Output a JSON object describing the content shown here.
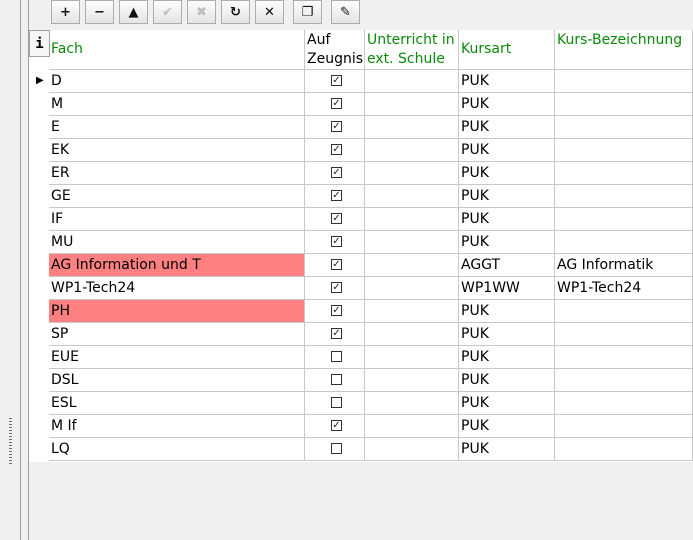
{
  "toolbar": {
    "buttons": [
      {
        "name": "add-button",
        "glyph": "+",
        "enabled": true
      },
      {
        "name": "remove-button",
        "glyph": "−",
        "enabled": true
      },
      {
        "name": "move-up-button",
        "glyph": "▲",
        "enabled": true
      },
      {
        "name": "confirm-button",
        "glyph": "✔",
        "enabled": false
      },
      {
        "name": "cancel-button",
        "glyph": "✖",
        "enabled": false
      },
      {
        "name": "refresh-button",
        "glyph": "↻",
        "enabled": true
      },
      {
        "name": "delete-document-button",
        "glyph": "✕",
        "enabled": true
      },
      {
        "name": "copy-document-button",
        "glyph": "❐",
        "enabled": true
      },
      {
        "name": "edit-document-button",
        "glyph": "✎",
        "enabled": true
      }
    ]
  },
  "grid": {
    "info_label": "i",
    "columns": [
      {
        "label": "Fach"
      },
      {
        "label": "Auf Zeugnis"
      },
      {
        "label": "Unterricht in ext. Schule"
      },
      {
        "label": "Kursart"
      },
      {
        "label": "Kurs-Bezeichnung"
      }
    ],
    "rows": [
      {
        "fach": "D",
        "checked": true,
        "ext": "",
        "kursart": "PUK",
        "bez": "",
        "highlight": false,
        "current": true
      },
      {
        "fach": "M",
        "checked": true,
        "ext": "",
        "kursart": "PUK",
        "bez": "",
        "highlight": false
      },
      {
        "fach": "E",
        "checked": true,
        "ext": "",
        "kursart": "PUK",
        "bez": "",
        "highlight": false
      },
      {
        "fach": "EK",
        "checked": true,
        "ext": "",
        "kursart": "PUK",
        "bez": "",
        "highlight": false
      },
      {
        "fach": "ER",
        "checked": true,
        "ext": "",
        "kursart": "PUK",
        "bez": "",
        "highlight": false
      },
      {
        "fach": "GE",
        "checked": true,
        "ext": "",
        "kursart": "PUK",
        "bez": "",
        "highlight": false
      },
      {
        "fach": "IF",
        "checked": true,
        "ext": "",
        "kursart": "PUK",
        "bez": "",
        "highlight": false
      },
      {
        "fach": "MU",
        "checked": true,
        "ext": "",
        "kursart": "PUK",
        "bez": "",
        "highlight": false
      },
      {
        "fach": "AG Information und T",
        "checked": true,
        "ext": "",
        "kursart": "AGGT",
        "bez": "AG Informatik",
        "highlight": true
      },
      {
        "fach": "WP1-Tech24",
        "checked": true,
        "ext": "",
        "kursart": "WP1WW",
        "bez": "WP1-Tech24",
        "highlight": false
      },
      {
        "fach": "PH",
        "checked": true,
        "ext": "",
        "kursart": "PUK",
        "bez": "",
        "highlight": true
      },
      {
        "fach": "SP",
        "checked": true,
        "ext": "",
        "kursart": "PUK",
        "bez": "",
        "highlight": false
      },
      {
        "fach": "EUE",
        "checked": false,
        "ext": "",
        "kursart": "PUK",
        "bez": "",
        "highlight": false
      },
      {
        "fach": "DSL",
        "checked": false,
        "ext": "",
        "kursart": "PUK",
        "bez": "",
        "highlight": false
      },
      {
        "fach": "ESL",
        "checked": false,
        "ext": "",
        "kursart": "PUK",
        "bez": "",
        "highlight": false
      },
      {
        "fach": "M If",
        "checked": true,
        "ext": "",
        "kursart": "PUK",
        "bez": "",
        "highlight": false
      },
      {
        "fach": "LQ",
        "checked": false,
        "ext": "",
        "kursart": "PUK",
        "bez": "",
        "highlight": false
      }
    ]
  },
  "colors": {
    "highlight": "#ff8080",
    "header_green": "#0a8a0a",
    "grid_line": "#c8c8c8"
  }
}
